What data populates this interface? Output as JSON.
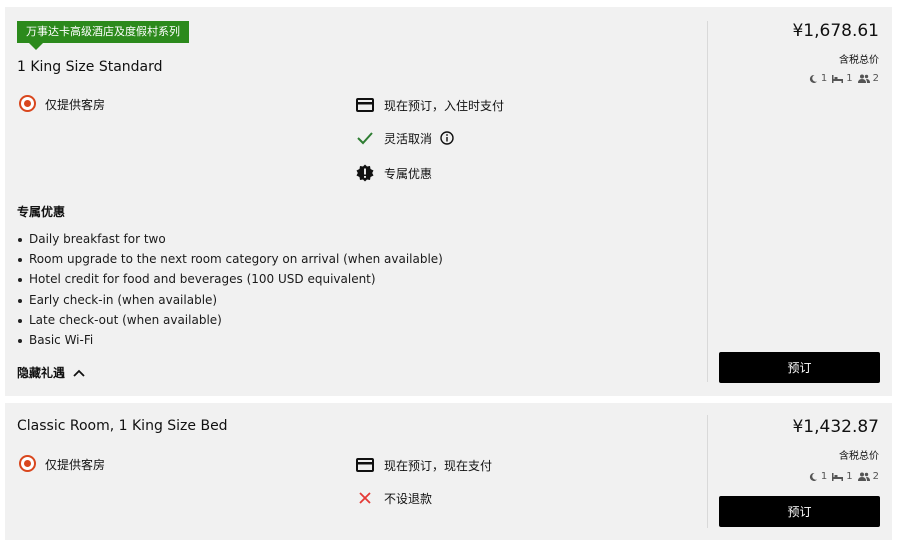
{
  "rooms": [
    {
      "badge": "万事达卡高级酒店及度假村系列",
      "title": "1 King Size Standard",
      "rate_option": "仅提供客房",
      "features": [
        {
          "icon": "credit-card-icon",
          "label": "现在预订，入住时支付"
        },
        {
          "icon": "checkmark-icon",
          "label": "灵活取消"
        },
        {
          "icon": "exclusive-offer-icon",
          "label": "专属优惠"
        }
      ],
      "perks_heading": "专属优惠",
      "perks": [
        "Daily breakfast for two",
        "Room upgrade to the next room category on arrival (when available)",
        "Hotel credit for food and beverages (100 USD equivalent)",
        "Early check-in (when available)",
        "Late check-out (when available)",
        "Basic Wi-Fi"
      ],
      "hide_perks_label": "隐藏礼遇",
      "price": "¥1,678.61",
      "price_note": "含税总价",
      "nights": "1",
      "beds": "1",
      "guests": "2",
      "book_label": "预订"
    },
    {
      "title": "Classic Room, 1 King Size Bed",
      "rate_option": "仅提供客房",
      "features": [
        {
          "icon": "credit-card-icon",
          "label": "现在预订，现在支付"
        },
        {
          "icon": "cross-icon",
          "label": "不设退款"
        }
      ],
      "price": "¥1,432.87",
      "price_note": "含税总价",
      "nights": "1",
      "beds": "1",
      "guests": "2",
      "book_label": "预订"
    }
  ],
  "colors": {
    "accent_orange": "#d9471e",
    "badge_green": "#2c8a1c",
    "check_green": "#2e7d32",
    "cross_red": "#e53935",
    "button_black": "#000000"
  }
}
